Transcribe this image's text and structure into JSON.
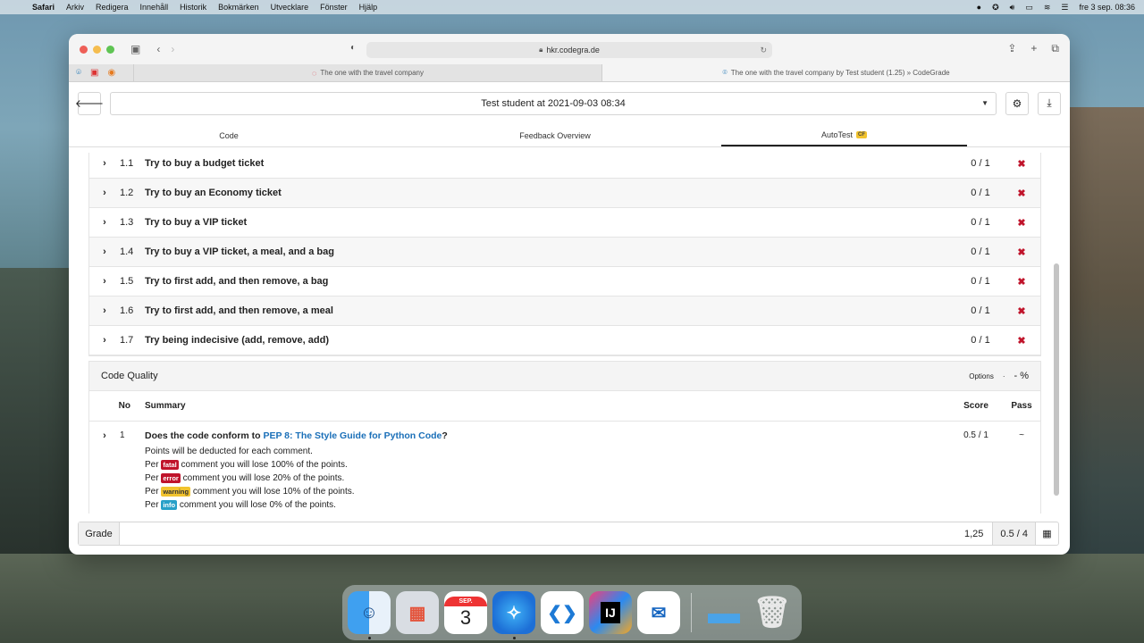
{
  "menubar": {
    "app": "Safari",
    "items": [
      "Arkiv",
      "Redigera",
      "Innehåll",
      "Historik",
      "Bokmärken",
      "Utvecklare",
      "Fönster",
      "Hjälp"
    ],
    "clock": "fre 3 sep.  08:36"
  },
  "browser": {
    "url": "hkr.codegra.de",
    "tabs": [
      {
        "title": "The one with the travel company",
        "active": false
      },
      {
        "title": "The one with the travel company by Test student (1.25) » CodeGrade",
        "active": true
      }
    ]
  },
  "header": {
    "submission_select": "Test student at 2021-09-03 08:34"
  },
  "nav": {
    "code": "Code",
    "feedback": "Feedback Overview",
    "autotest": "AutoTest",
    "autotest_badge": "CF"
  },
  "tests": [
    {
      "num": "1.1",
      "name": "Try to buy a budget ticket",
      "score": "0 / 1"
    },
    {
      "num": "1.2",
      "name": "Try to buy an Economy ticket",
      "score": "0 / 1"
    },
    {
      "num": "1.3",
      "name": "Try to buy a VIP ticket",
      "score": "0 / 1"
    },
    {
      "num": "1.4",
      "name": "Try to buy a VIP ticket, a meal, and a bag",
      "score": "0 / 1"
    },
    {
      "num": "1.5",
      "name": "Try to first add, and then remove, a bag",
      "score": "0 / 1"
    },
    {
      "num": "1.6",
      "name": "Try to first add, and then remove, a meal",
      "score": "0 / 1"
    },
    {
      "num": "1.7",
      "name": "Try being indecisive (add, remove, add)",
      "score": "0 / 1"
    }
  ],
  "code_quality": {
    "title": "Code Quality",
    "options": "Options",
    "dot": "·",
    "percent": "- %",
    "columns": {
      "no": "No",
      "summary": "Summary",
      "score": "Score",
      "pass": "Pass"
    },
    "row": {
      "num": "1",
      "question_pre": "Does the code conform to ",
      "question_link": "PEP 8: The Style Guide for Python Code",
      "question_post": "?",
      "deduct": "Points will be deducted for each comment.",
      "per": "Per",
      "fatal_label": "fatal",
      "fatal_text": "comment you will lose 100% of the points.",
      "error_label": "error",
      "error_text": "comment you will lose 20% of the points.",
      "warning_label": "warning",
      "warning_text": "comment you will lose 10% of the points.",
      "info_label": "info",
      "info_text": "comment you will lose 0% of the points.",
      "score": "0.5 / 1",
      "pass": "~"
    }
  },
  "grade": {
    "label": "Grade",
    "value": "1,25",
    "max": "0.5 / 4"
  },
  "dock": {
    "calendar_month": "SEP.",
    "calendar_day": "3",
    "ij_label": "IJ"
  }
}
